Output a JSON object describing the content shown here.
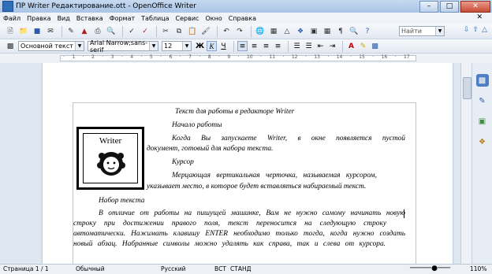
{
  "window": {
    "title": "ПР Writer Редактирование.ott - OpenOffice Writer"
  },
  "menu": [
    "Файл",
    "Правка",
    "Вид",
    "Вставка",
    "Формат",
    "Таблица",
    "Сервис",
    "Окно",
    "Справка"
  ],
  "toolbar": {
    "search_placeholder": "Найти"
  },
  "format": {
    "style": "Основной текст",
    "font": "Arial Narrow;sans-serif",
    "size": "12",
    "bold": "Ж",
    "italic": "К",
    "underline": "Ч"
  },
  "document": {
    "title_line": "Текст для работы в редакторе Writer",
    "h_start": "Начало работы",
    "p1_l1": "Когда Вы запускаете Writer, в окне появляется пустой",
    "p1_l2": "документ, готовый для набора текста.",
    "h_cursor": "Курсор",
    "p2_l1": "Мерцающая вертикальная черточка, называемая курсором,",
    "p2_l2": "указывает место, в которое будет вставляться набираемый текст.",
    "h_typing": "Набор текста",
    "p3_l1": "В отличие от работы на пишущей машинке, Вам не нужно самому начинать новую",
    "p3_l2": "строку при достижении правого поля, текст переносится на следующую строку",
    "p3_l3": "автоматически. Нажимать клавишу ENTER необходимо только тогда, когда нужно создать",
    "p3_l4": "новый абзац. Набранные символы можно удалять как справа, так и слева от курсора.",
    "logo_text": "Writer"
  },
  "status": {
    "page": "Страница  1 / 1",
    "style": "Обычный",
    "lang": "Русский",
    "mode1": "ВСТ",
    "mode2": "СТАНД",
    "zoom": "110%"
  }
}
